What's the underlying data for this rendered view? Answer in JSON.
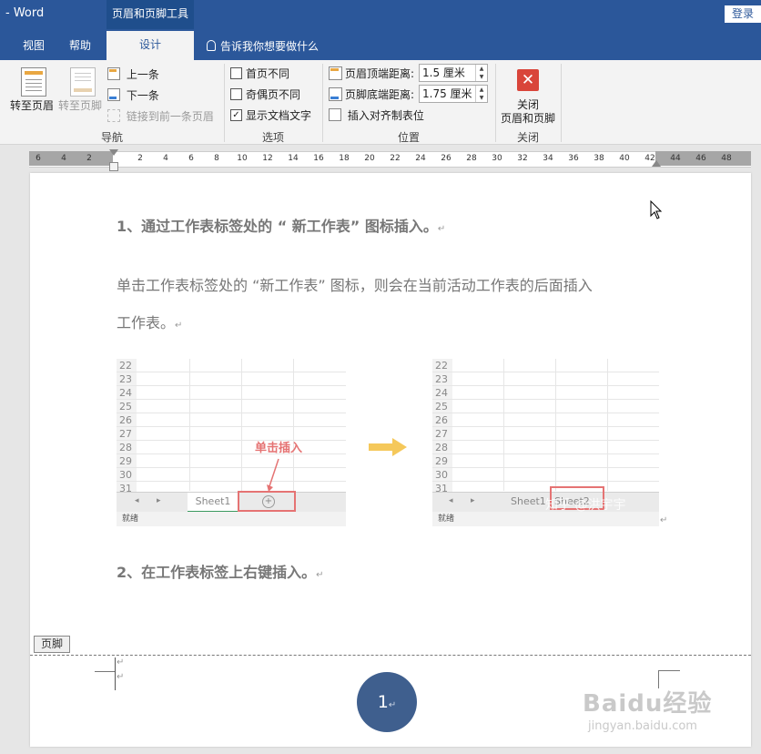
{
  "titlebar": {
    "app_title": "-  Word",
    "context_tools": "页眉和页脚工具",
    "login_label": "登录"
  },
  "tabs": {
    "view": "视图",
    "help": "帮助",
    "design": "设计",
    "tell_me": "告诉我你想要做什么"
  },
  "ribbon": {
    "nav": {
      "goto_header": "转至页眉",
      "goto_footer": "转至页脚",
      "previous": "上一条",
      "next": "下一条",
      "link_previous": "链接到前一条页眉",
      "group_label": "导航"
    },
    "options": {
      "different_first": "首页不同",
      "different_odd_even": "奇偶页不同",
      "show_doc_text": "显示文档文字",
      "show_doc_text_checked": true,
      "group_label": "选项"
    },
    "position": {
      "header_top_label": "页眉顶端距离:",
      "header_top_value": "1.5 厘米",
      "footer_bottom_label": "页脚底端距离:",
      "footer_bottom_value": "1.75 厘米",
      "insert_align_tab": "插入对齐制表位",
      "group_label": "位置"
    },
    "close": {
      "label_line1": "关闭",
      "label_line2": "页眉和页脚",
      "group_label": "关闭"
    }
  },
  "ruler": {
    "left_ticks": [
      "6",
      "4",
      "2"
    ],
    "ticks": [
      "2",
      "4",
      "6",
      "8",
      "10",
      "12",
      "14",
      "16",
      "18",
      "20",
      "22",
      "24",
      "26",
      "28",
      "30",
      "32",
      "34",
      "36",
      "38",
      "40",
      "42",
      "44",
      "46",
      "48"
    ]
  },
  "document": {
    "heading1": "1、通过工作表标签处的 “ 新工作表” 图标插入。",
    "para1_line1": "单击工作表标签处的 “新工作表” 图标，则会在当前活动工作表的后面插入",
    "para1_line2": "工作表。",
    "heading2": "2、在工作表标签上右键插入。",
    "paragraph_mark": "↵",
    "left_image": {
      "rows": [
        "22",
        "23",
        "24",
        "25",
        "26",
        "27",
        "28",
        "29",
        "30",
        "31"
      ],
      "sheet_tab": "Sheet1",
      "callout": "单击插入",
      "status": "就绪"
    },
    "right_image": {
      "rows": [
        "22",
        "23",
        "24",
        "25",
        "26",
        "27",
        "28",
        "29",
        "30",
        "31"
      ],
      "sheet_tab1": "Sheet1",
      "sheet_tab2": "Sheet2",
      "watermark": "知乎 @洪宇宇",
      "status": "就绪"
    }
  },
  "footer": {
    "tag": "页脚",
    "page_number": "1"
  },
  "watermarks": {
    "baidu": "Baidu经验",
    "url": "jingyan.baidu.com"
  },
  "colors": {
    "brand_blue": "#2b579a",
    "close_red": "#d9453a",
    "callout_red": "#e57373",
    "arrow_yellow": "#f5c85a",
    "page_number_circle": "#3f5f8e"
  }
}
